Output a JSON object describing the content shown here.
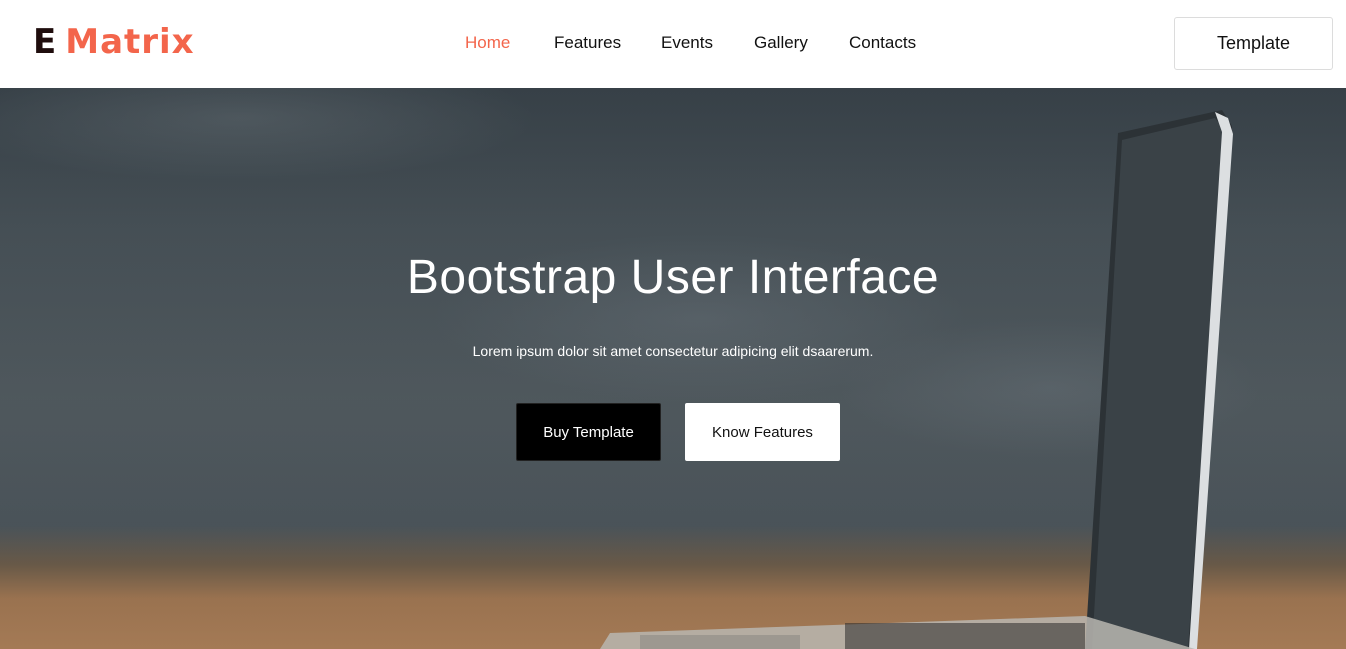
{
  "brand": {
    "part1": "E",
    "part2": "Matrix",
    "accent_color": "#f3654b"
  },
  "nav": {
    "items": [
      {
        "label": "Home",
        "active": true
      },
      {
        "label": "Features",
        "active": false
      },
      {
        "label": "Events",
        "active": false
      },
      {
        "label": "Gallery",
        "active": false
      },
      {
        "label": "Contacts",
        "active": false
      }
    ],
    "cta_label": "Template"
  },
  "hero": {
    "title": "Bootstrap User Interface",
    "subtitle": "Lorem ipsum dolor sit amet consectetur adipicing elit dsaarerum.",
    "primary_button": "Buy Template",
    "secondary_button": "Know Features",
    "background_image": "laptop-on-desk-photo"
  }
}
